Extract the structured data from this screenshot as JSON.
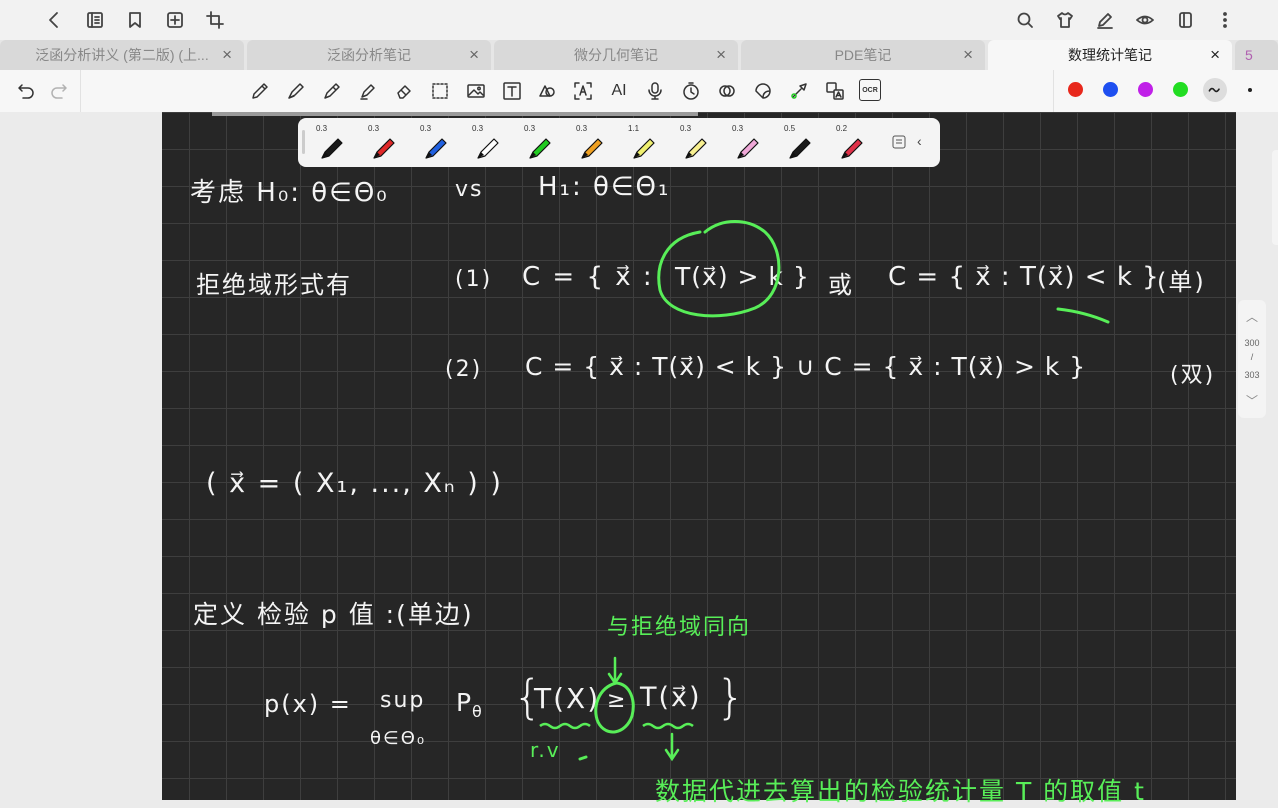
{
  "topbar": {
    "left_icons": [
      "back-icon",
      "notebook-icon",
      "bookmark-icon",
      "add-page-icon",
      "crop-icon"
    ],
    "right_icons": [
      "search-icon",
      "shirt-icon",
      "pen-edit-icon",
      "eye-icon",
      "page-layout-icon",
      "more-icon"
    ]
  },
  "tabs": [
    {
      "label": "泛函分析讲义 (第二版) (上...",
      "active": false
    },
    {
      "label": "泛函分析笔记",
      "active": false
    },
    {
      "label": "微分几何笔记",
      "active": false
    },
    {
      "label": "PDE笔记",
      "active": false
    },
    {
      "label": "数理统计笔记",
      "active": true
    },
    {
      "label": "5",
      "active": false
    }
  ],
  "tab_close": "×",
  "toolbar": {
    "tools": [
      "undo-icon",
      "redo-icon",
      "pencil-icon",
      "fountain-pen-icon",
      "ballpoint-icon",
      "highlighter-icon",
      "eraser-icon",
      "lasso-icon",
      "image-icon",
      "text-box-icon",
      "shapes-icon",
      "text-recognition-icon",
      "ai-icon",
      "microphone-icon",
      "timer-icon",
      "link-icon",
      "sticker-icon",
      "laser-pointer-icon",
      "translate-icon",
      "ocr-icon"
    ],
    "ai_label": "AI",
    "ocr_label": "OCR",
    "colors": [
      "#e8281c",
      "#1e4ff0",
      "#c020e8",
      "#22dd22"
    ]
  },
  "pens": [
    {
      "size": "0.3",
      "color": "#1a1a1a"
    },
    {
      "size": "0.3",
      "color": "#e02828"
    },
    {
      "size": "0.3",
      "color": "#2060e0"
    },
    {
      "size": "0.3",
      "color": "#ffffff"
    },
    {
      "size": "0.3",
      "color": "#22cc22"
    },
    {
      "size": "0.3",
      "color": "#f0a020"
    },
    {
      "size": "1.1",
      "color": "#f0f070"
    },
    {
      "size": "0.3",
      "color": "#f8f090"
    },
    {
      "size": "0.3",
      "color": "#f0a8d8"
    },
    {
      "size": "0.5",
      "color": "#1a1a1a"
    },
    {
      "size": "0.2",
      "color": "#e03048"
    }
  ],
  "pager": {
    "up": "︿",
    "current": "300",
    "slash": "/",
    "total": "303",
    "down": "﹀"
  },
  "notes": {
    "line1_a": "考虑  H₀: θ∈Θ₀",
    "line1_vs": "vs",
    "line1_b": "H₁: θ∈Θ₁",
    "reject_label": "拒绝域形式有",
    "case1": "(1)",
    "case1_c": "C = { x⃗ :",
    "case1_t": "T(x⃗) > k }",
    "case1_or": "或",
    "case1_c2": "C = { x⃗ : T(x⃗) < k }",
    "case1_tag": "(单)",
    "case2": "(2)",
    "case2_c": "C = { x⃗ : T(x⃗) < k }  ∪  C = { x⃗ : T(x⃗) > k }",
    "case2_tag": "(双)",
    "vec_def": "( x⃗ = ( X₁, ..., Xₙ ) )",
    "pdef": "定义 检验 p 值 :(单边)",
    "same_dir": "与拒绝域同向",
    "p_formula_lhs": "p(x) =",
    "sup": "sup",
    "sup_sub": "θ∈Θ₀",
    "p_theta": "P",
    "p_theta_sub": "θ",
    "brace_open": "{",
    "t_big": "T(X)",
    "geq": "≥",
    "t_obs": "T(x⃗)",
    "brace_close": "}",
    "rv": "r.v",
    "bottom_note": "数据代进去算出的检验统计量 T 的取值 t"
  }
}
